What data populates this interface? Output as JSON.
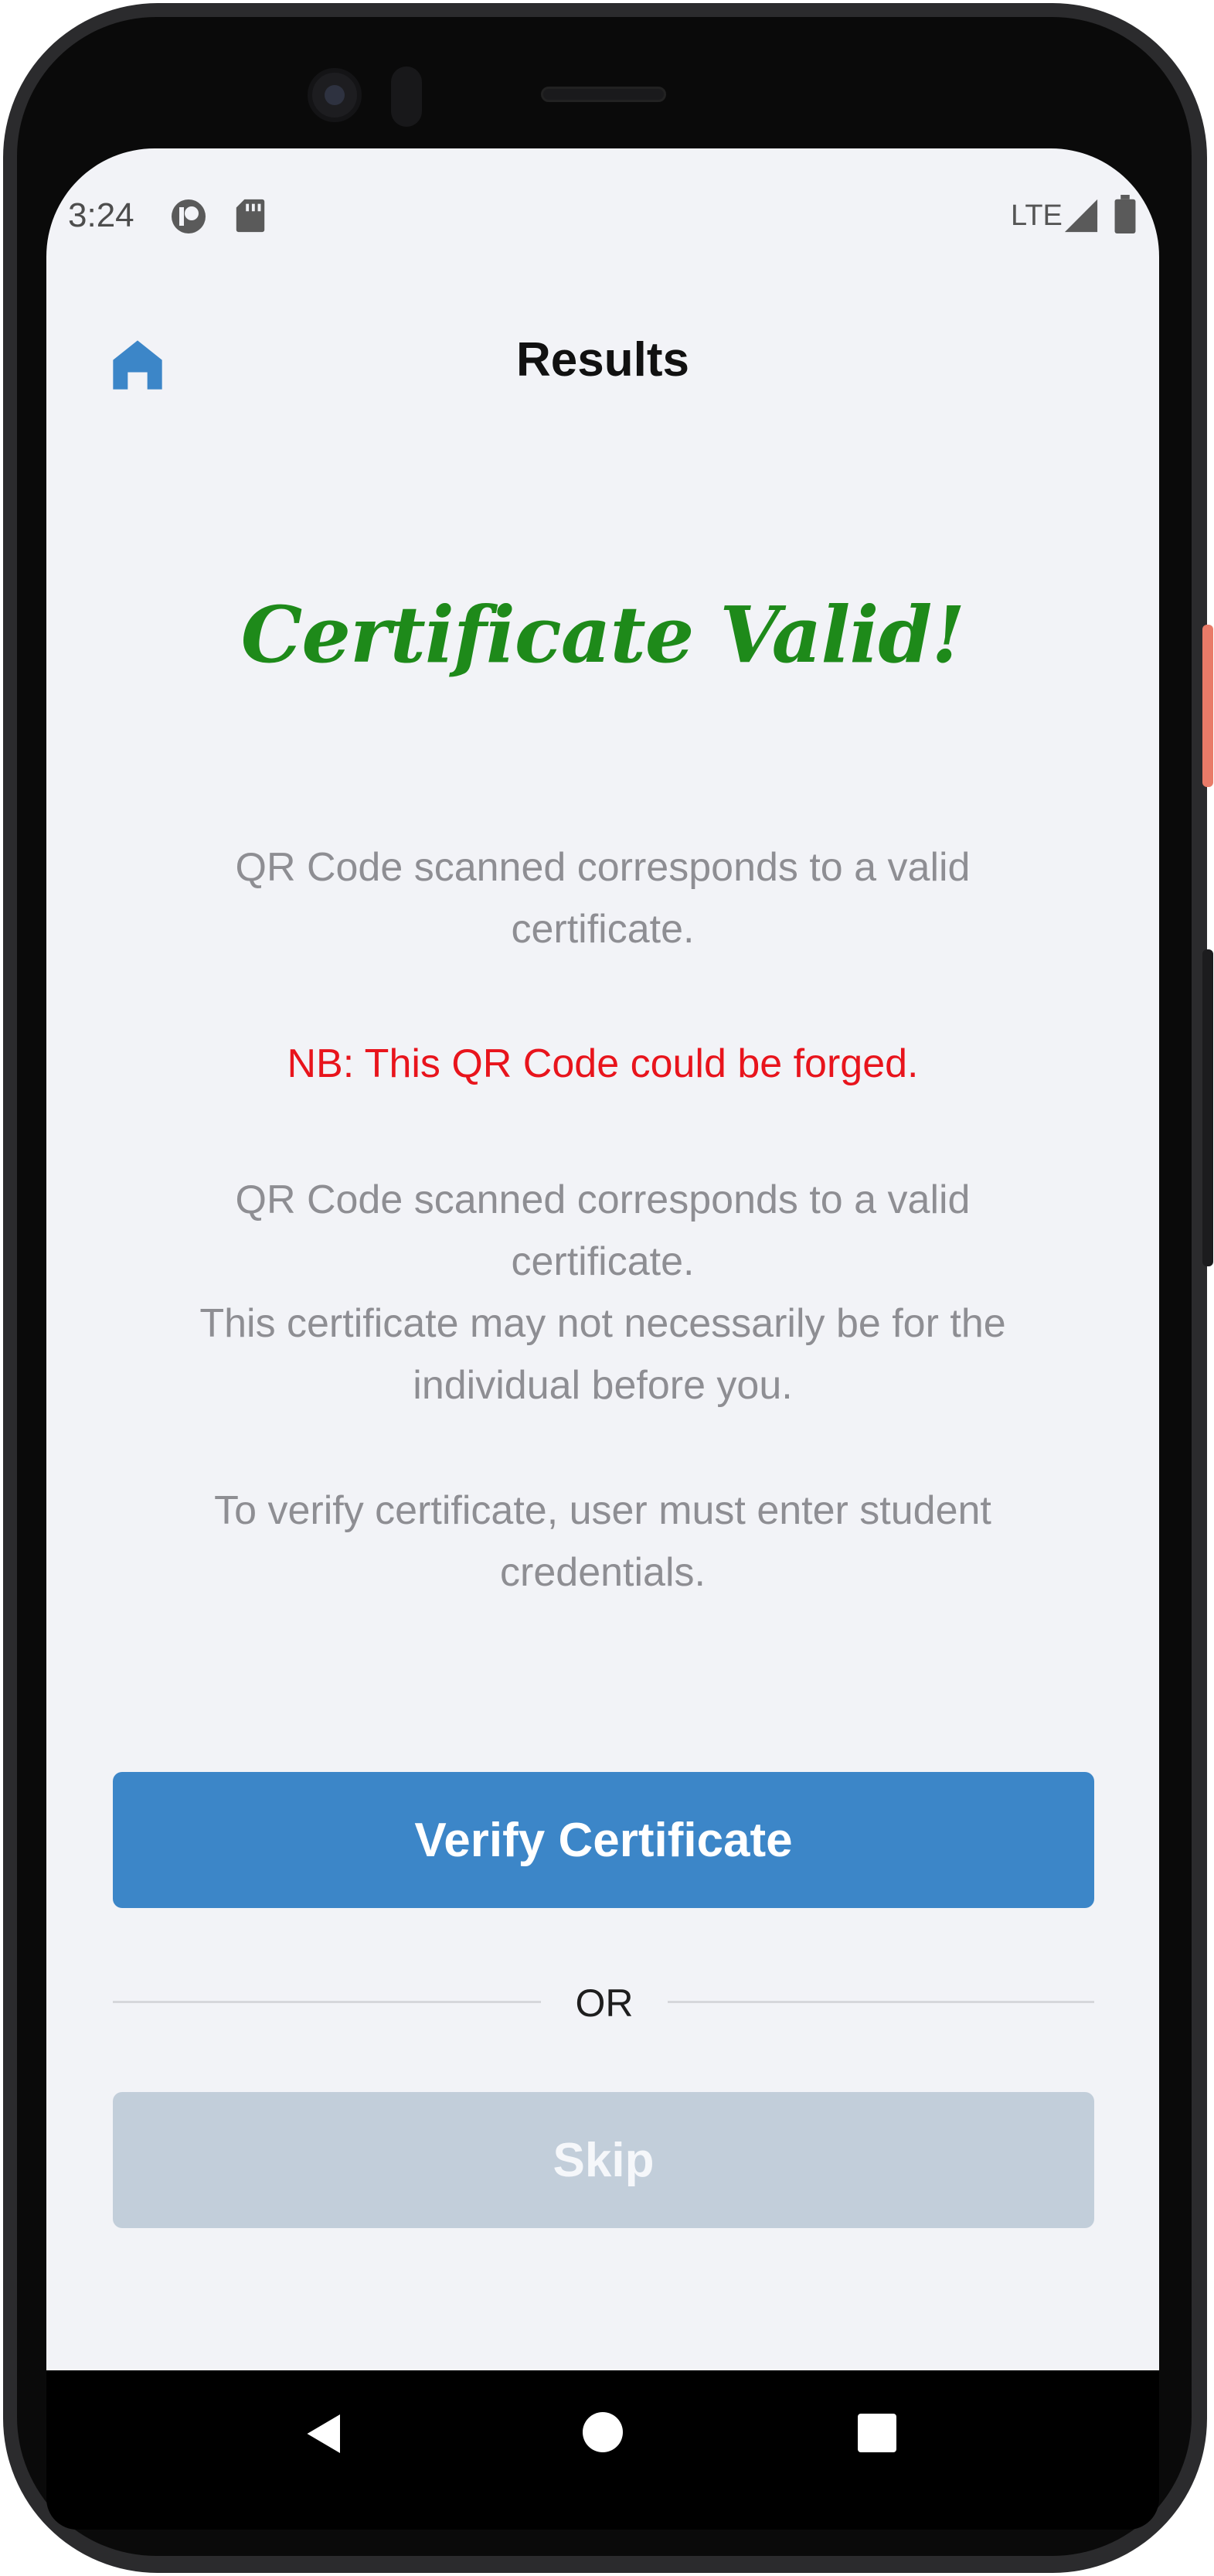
{
  "status_bar": {
    "time": "3:24",
    "network": "LTE",
    "icons": [
      "notification-app-icon",
      "sd-card-icon",
      "signal-icon",
      "battery-icon"
    ]
  },
  "header": {
    "title": "Results",
    "home_icon": "home-icon"
  },
  "result": {
    "headline": "Certificate Valid!",
    "headline_color": "#1e8a1a",
    "message_1": "QR Code scanned corresponds to a valid certificate.",
    "warning": "NB: This QR Code could be forged.",
    "warning_color": "#e8141c",
    "message_2": "QR Code scanned corresponds to a valid certificate.",
    "message_3": "This certificate may not necessarily be for the individual before you.",
    "message_4": "To verify certificate, user must enter student credentials."
  },
  "actions": {
    "primary_label": "Verify Certificate",
    "primary_color": "#3c86c8",
    "separator_label": "OR",
    "secondary_label": "Skip",
    "secondary_color": "#c2ceda"
  },
  "nav_bar": {
    "back_icon": "back-triangle-icon",
    "home_icon": "home-circle-icon",
    "recents_icon": "recents-square-icon"
  }
}
